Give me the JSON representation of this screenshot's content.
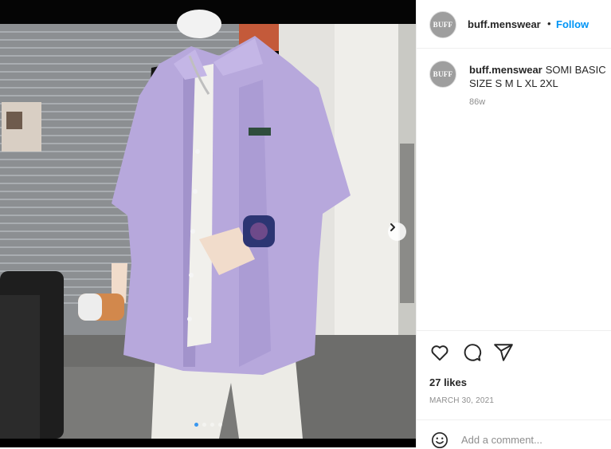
{
  "header": {
    "avatar_text": "BUFF",
    "username": "buff.menswear",
    "separator": "•",
    "follow_label": "Follow"
  },
  "caption": {
    "avatar_text": "BUFF",
    "username": "buff.menswear",
    "text": "SOMI BASIC SIZE S M L XL 2XL",
    "time": "86w"
  },
  "carousel": {
    "dot_count": 4,
    "active_index": 0,
    "next_icon": "chevron-right-icon"
  },
  "actions": {
    "like_icon": "heart-icon",
    "comment_icon": "comment-icon",
    "share_icon": "share-icon"
  },
  "likes": "27 likes",
  "date": "MARCH 30, 2021",
  "comment": {
    "emoji_icon": "emoji-icon",
    "placeholder": "Add a comment..."
  },
  "colors": {
    "follow": "#0095f6",
    "active_dot": "#3897f0",
    "shirt": "#b7a8dc"
  }
}
